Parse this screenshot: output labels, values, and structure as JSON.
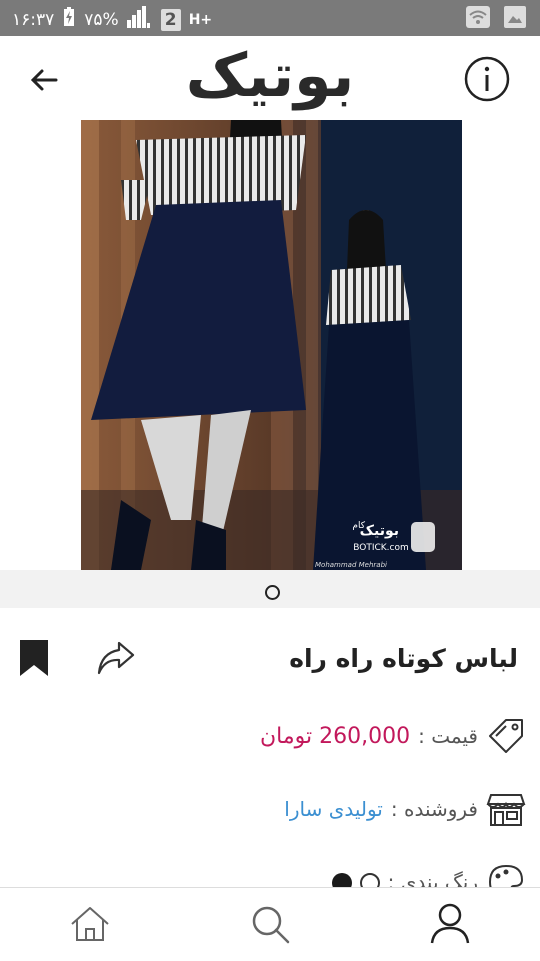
{
  "status_bar": {
    "time": "۱۶:۳۷",
    "battery": "۷۵%",
    "sim_badge": "2",
    "network": "H+"
  },
  "app": {
    "logo_text": "بوتیک"
  },
  "gallery": {
    "watermark_brand": "بوتیک",
    "watermark_suffix": "کام",
    "watermark_url": "BOTICK.com",
    "photographer": "Mohammad Mehrabi"
  },
  "product": {
    "title": "لباس کوتاه راه راه",
    "price_label": "قیمت :",
    "price_value": "260,000 تومان",
    "seller_label": "فروشنده :",
    "seller_value": "تولیدی سارا",
    "color_label": "رنگ بندی :",
    "colors": [
      "#ffffff",
      "#1a1a1a"
    ]
  },
  "colors": {
    "price": "#c2185b",
    "seller": "#3b8fd1",
    "status_bar": "#7a7a7a"
  },
  "icons": {
    "back": "arrow-left-icon",
    "info": "info-icon",
    "bookmark": "bookmark-icon",
    "share": "share-icon",
    "price": "price-tag-icon",
    "seller": "store-icon",
    "color": "palette-icon",
    "nav_home": "home-icon",
    "nav_search": "search-icon",
    "nav_profile": "user-icon"
  }
}
